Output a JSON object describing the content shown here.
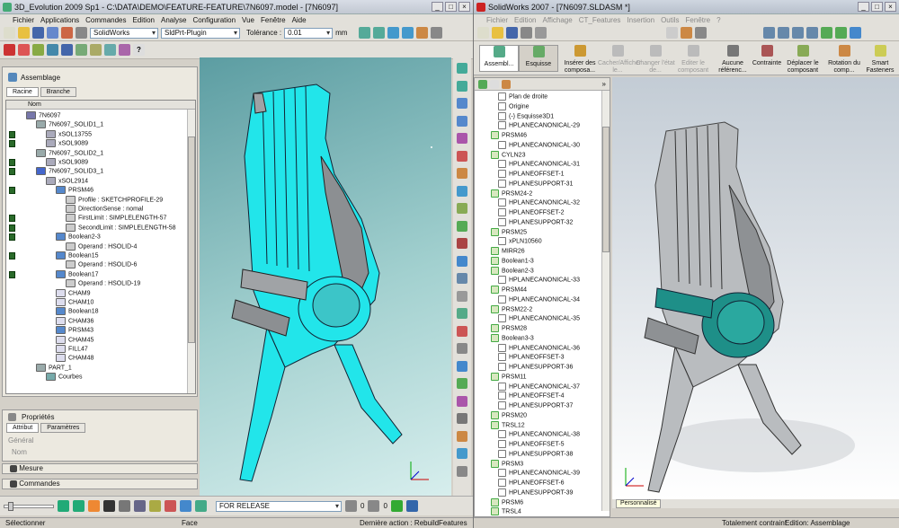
{
  "left": {
    "title": "3D_Evolution 2009 Sp1 - C:\\DATA\\DEMO\\FEATURE-FEATURE\\7N6097.model - [7N6097]",
    "menu": [
      "Fichier",
      "Applications",
      "Commandes",
      "Edition",
      "Analyse",
      "Configuration",
      "Vue",
      "Fenêtre",
      "Aide"
    ],
    "combo1": "SolidWorks",
    "combo2": "SldPrt-Plugin",
    "tolerance_label": "Tolérance :",
    "tolerance_value": "0.01",
    "unit": "mm",
    "panel_title": "Assemblage",
    "tabs": [
      "Racine",
      "Branche"
    ],
    "col_header": "Nom",
    "tree": [
      "7N6097",
      "7N6097_SOLID1_1",
      "xSOL13755",
      "xSOL9089",
      "7N6097_SOLID2_1",
      "xSOL9089",
      "7N6097_SOLID3_1",
      "xSOL2914",
      "PRSM46",
      "Profile : SKETCHPROFILE-29",
      "DirectionSense : nomal",
      "FirstLimit : SIMPLELENGTH-57",
      "SecondLimit : SIMPLELENGTH-58",
      "Boolean2-3",
      "Operand : HSOLID-4",
      "Boolean15",
      "Operand : HSOLID-6",
      "Boolean17",
      "Operand : HSOLID-19",
      "CHAM9",
      "CHAM10",
      "Boolean18",
      "CHAM36",
      "PRSM43",
      "CHAM45",
      "FILL47",
      "CHAM48",
      "PART_1",
      "Courbes"
    ],
    "props_title": "Propriétés",
    "props_tabs": [
      "Attribut",
      "Paramètres"
    ],
    "props_group": "Général",
    "props_field": "Nom",
    "mesure": "Mesure",
    "commandes": "Commandes",
    "release": "FOR RELEASE",
    "count1": "0",
    "count2": "0",
    "status": [
      "Sélectionner",
      "Face",
      "Dernière action : RebuildFeatures"
    ]
  },
  "right": {
    "title": "SolidWorks 2007 - [7N6097.SLDASM *]",
    "menu": [
      "Fichier",
      "Edition",
      "Affichage",
      "CT_Features",
      "Insertion",
      "Outils",
      "Fenêtre",
      "?"
    ],
    "big_buttons": [
      "Assembl...",
      "Esquisse",
      "Insérer des composa...",
      "Cacher/Afficher le...",
      "Changer l'état de...",
      "Editer le composant",
      "Aucune référenc...",
      "Contrainte",
      "Déplacer le composant",
      "Rotation du comp...",
      "Smart Fasteners"
    ],
    "tree": [
      "Plan de droite",
      "Origine",
      "(-) Esquisse3D1",
      "HPLANECANONICAL-29",
      "PRSM46",
      "HPLANECANONICAL-30",
      "CYLN23",
      "HPLANECANONICAL-31",
      "HPLANEOFFSET-1",
      "HPLANESUPPORT-31",
      "PRSM24-2",
      "HPLANECANONICAL-32",
      "HPLANEOFFSET-2",
      "HPLANESUPPORT-32",
      "PRSM25",
      "xPLN10560",
      "MIRR26",
      "Boolean1-3",
      "Boolean2-3",
      "HPLANECANONICAL-33",
      "PRSM44",
      "HPLANECANONICAL-34",
      "PRSM22-2",
      "HPLANECANONICAL-35",
      "PRSM28",
      "Boolean3-3",
      "HPLANECANONICAL-36",
      "HPLANEOFFSET-3",
      "HPLANESUPPORT-36",
      "PRSM11",
      "HPLANECANONICAL-37",
      "HPLANEOFFSET-4",
      "HPLANESUPPORT-37",
      "PRSM20",
      "TRSL12",
      "HPLANECANONICAL-38",
      "HPLANEOFFSET-5",
      "HPLANESUPPORT-38",
      "PRSM3",
      "HPLANECANONICAL-39",
      "HPLANEOFFSET-6",
      "HPLANESUPPORT-39",
      "PRSM6",
      "TRSL4"
    ],
    "personnalise": "Personnalisé",
    "status": [
      "Totalement contraint",
      "Edition: Assemblage"
    ]
  }
}
